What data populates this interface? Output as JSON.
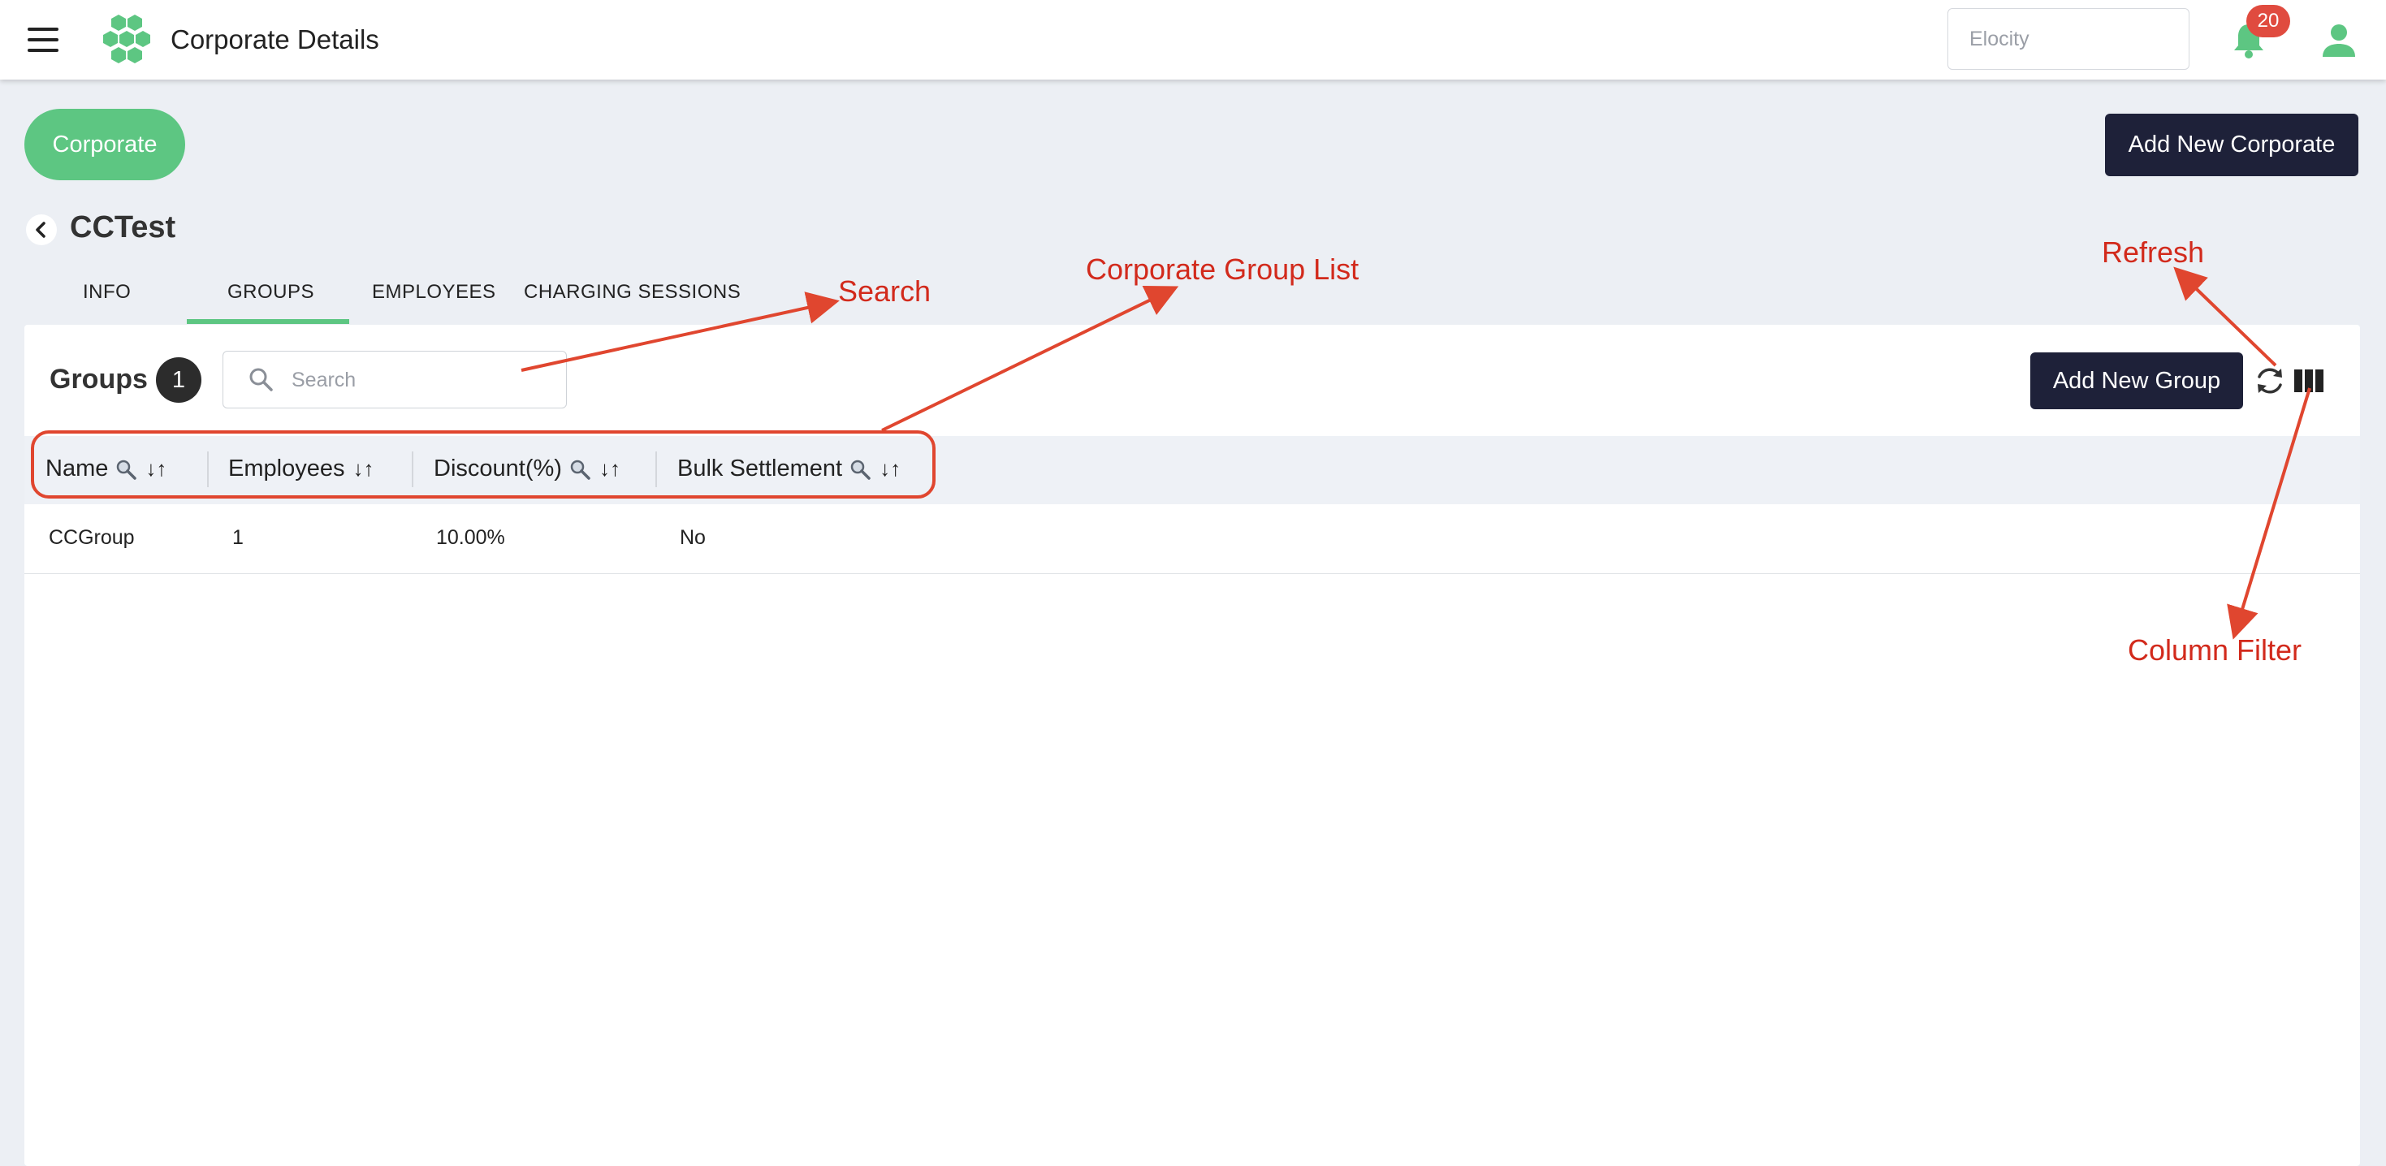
{
  "app": {
    "title": "Corporate Details",
    "tenant_selector": "Elocity",
    "notification_count": "20"
  },
  "header": {
    "corporate_pill": "Corporate",
    "add_corporate_button": "Add New Corporate",
    "corporate_name": "CCTest"
  },
  "tabs": [
    {
      "label": "INFO",
      "active": false
    },
    {
      "label": "GROUPS",
      "active": true
    },
    {
      "label": "EMPLOYEES",
      "active": false
    },
    {
      "label": "CHARGING SESSIONS",
      "active": false
    }
  ],
  "groups": {
    "title": "Groups",
    "count": "1",
    "search_placeholder": "Search",
    "add_group_button": "Add New Group"
  },
  "table": {
    "columns": [
      {
        "label": "Name",
        "filter": true,
        "sort": "↓↑"
      },
      {
        "label": "Employees",
        "filter": false,
        "sort": "↓↑"
      },
      {
        "label": "Discount(%)",
        "filter": true,
        "sort": "↓↑"
      },
      {
        "label": "Bulk Settlement",
        "filter": true,
        "sort": "↓↑"
      }
    ],
    "rows": [
      {
        "name": "CCGroup",
        "employees": "1",
        "discount": "10.00%",
        "bulk_settlement": "No"
      }
    ]
  },
  "annotations": {
    "search": "Search",
    "corporate_group_list": "Corporate Group List",
    "refresh": "Refresh",
    "column_filter": "Column Filter"
  },
  "colors": {
    "accent_green": "#5dc682",
    "dark_navy": "#1e2139",
    "badge_red": "#e04b3f",
    "annotation_red": "#d22a1c",
    "background": "#eceff4"
  },
  "icons": {
    "menu": "hamburger-icon",
    "logo": "hexagon-cluster-logo",
    "notifications": "bell-icon",
    "user": "user-icon",
    "back": "chevron-left-icon",
    "search": "magnifier-icon",
    "refresh": "refresh-icon",
    "columns": "column-view-icon"
  }
}
